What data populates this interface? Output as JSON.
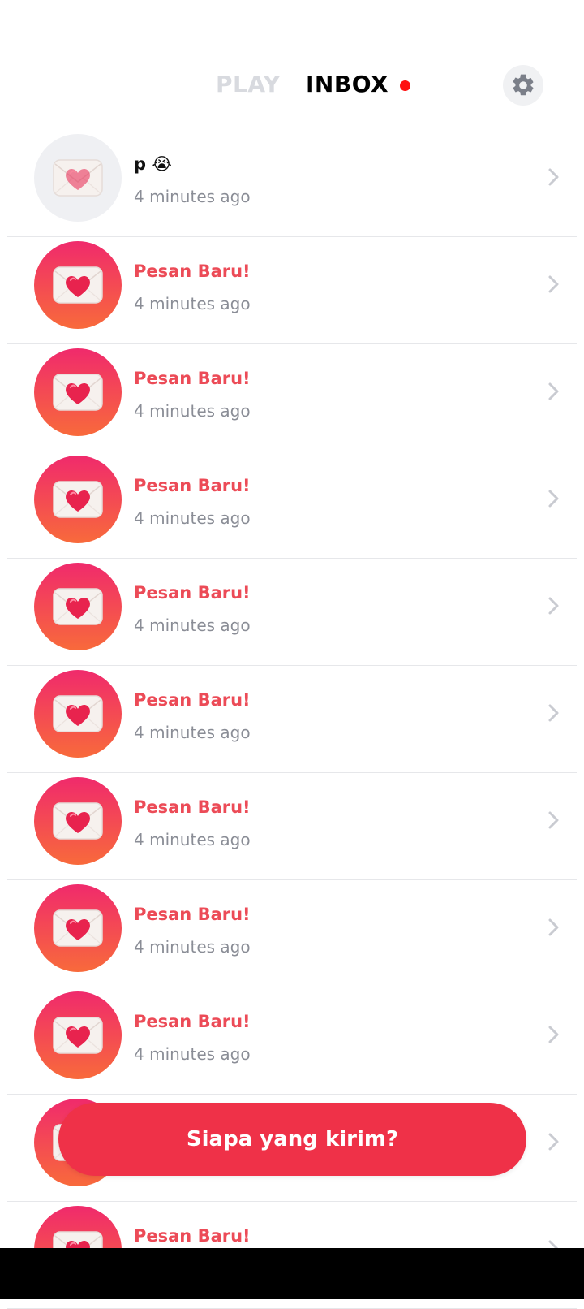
{
  "header": {
    "tab_play": "PLAY",
    "tab_inbox": "INBOX",
    "settings_icon": "gear-icon",
    "unread_indicator_color": "#ff1010"
  },
  "inbox": {
    "items": [
      {
        "title": "p 😭",
        "time": "4 minutes ago",
        "state": "read"
      },
      {
        "title": "Pesan Baru!",
        "time": "4 minutes ago",
        "state": "new"
      },
      {
        "title": "Pesan Baru!",
        "time": "4 minutes ago",
        "state": "new"
      },
      {
        "title": "Pesan Baru!",
        "time": "4 minutes ago",
        "state": "new"
      },
      {
        "title": "Pesan Baru!",
        "time": "4 minutes ago",
        "state": "new"
      },
      {
        "title": "Pesan Baru!",
        "time": "4 minutes ago",
        "state": "new"
      },
      {
        "title": "Pesan Baru!",
        "time": "4 minutes ago",
        "state": "new"
      },
      {
        "title": "Pesan Baru!",
        "time": "4 minutes ago",
        "state": "new"
      },
      {
        "title": "Pesan Baru!",
        "time": "4 minutes ago",
        "state": "new"
      },
      {
        "title": "",
        "time": "",
        "state": "new"
      },
      {
        "title": "Pesan Baru!",
        "time": "",
        "state": "new"
      }
    ]
  },
  "cta": {
    "label": "Siapa yang kirim?"
  },
  "colors": {
    "accent": "#ef3148",
    "new_title": "#ec4b57",
    "gradient_top": "#f02a6c",
    "gradient_bottom": "#f86a3b",
    "muted_text": "#8a8d96"
  }
}
